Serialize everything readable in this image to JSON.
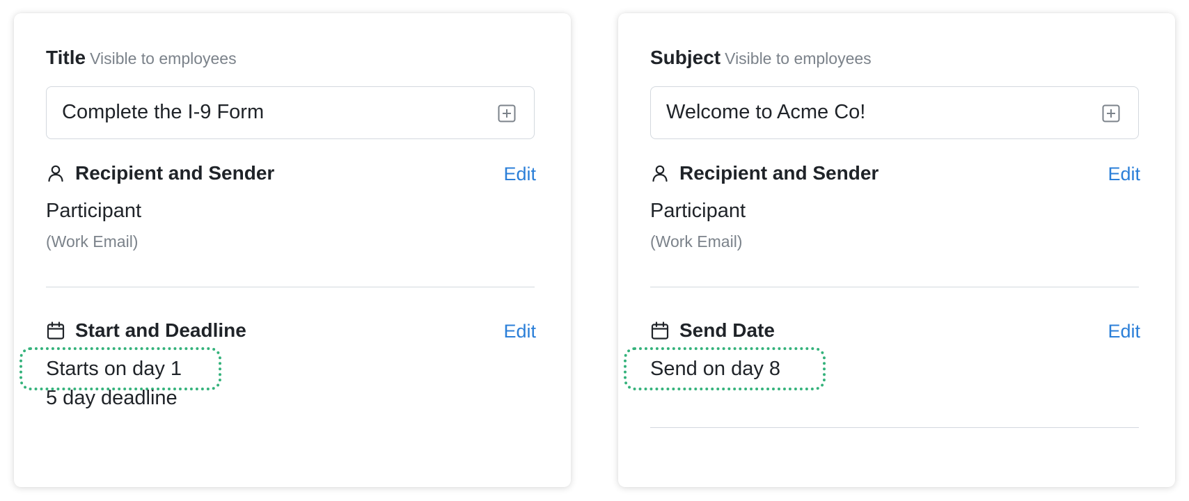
{
  "left_card": {
    "field_label": "Title",
    "field_hint": "Visible to employees",
    "field_value": "Complete the I-9 Form",
    "recipient_section_title": "Recipient and Sender",
    "recipient_edit": "Edit",
    "recipient_name": "Participant",
    "recipient_email": "(Work Email)",
    "schedule_section_title": "Start and Deadline",
    "schedule_edit": "Edit",
    "schedule_line1": "Starts on day 1",
    "schedule_line2": "5 day deadline"
  },
  "right_card": {
    "field_label": "Subject",
    "field_hint": "Visible to employees",
    "field_value": "Welcome to Acme Co!",
    "recipient_section_title": "Recipient and Sender",
    "recipient_edit": "Edit",
    "recipient_name": "Participant",
    "recipient_email": "(Work Email)",
    "schedule_section_title": "Send Date",
    "schedule_edit": "Edit",
    "schedule_line1": "Send on day 8"
  },
  "icons": {
    "field_action": "plus-square-icon",
    "recipient": "person-icon",
    "schedule": "calendar-icon"
  },
  "colors": {
    "link": "#2b7fd8",
    "highlight": "#34b27b",
    "muted_text": "#7b828a",
    "divider": "#d3d8de"
  }
}
